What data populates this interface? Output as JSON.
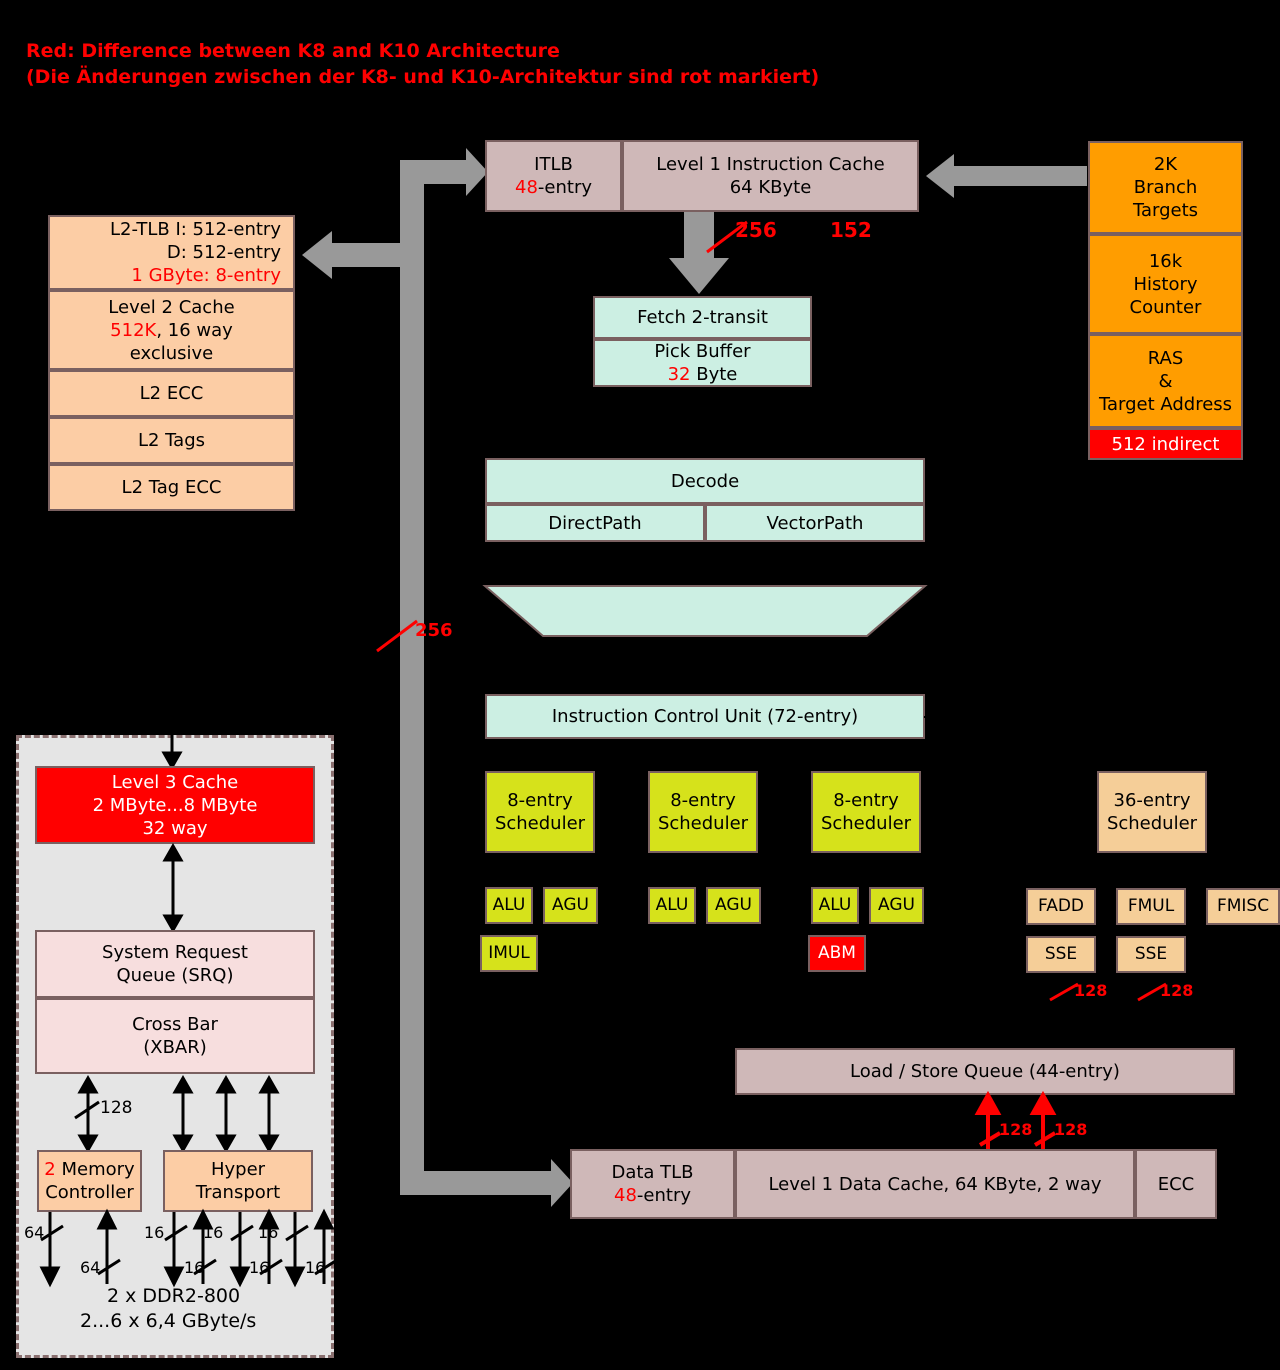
{
  "legend": {
    "line1": "Red: Difference between K8 and K10 Architecture",
    "line2": "(Die Änderungen zwischen der K8- und K10-Architektur sind rot markiert)",
    "color": "#FF0000"
  },
  "frontend": {
    "itlb": {
      "title": "ITLB",
      "value_red": "48",
      "value_rest": "-entry"
    },
    "l1_icache": {
      "line1": "Level 1 Instruction Cache",
      "line2": "64 KByte"
    },
    "bus_label_256": "256",
    "bus_label_152": "152",
    "fetch": {
      "line1": "Fetch 2-transit"
    },
    "pick_buffer": {
      "title": "Pick Buffer",
      "value_red": "32",
      "value_rest": " Byte"
    }
  },
  "l2_block": {
    "tlb": {
      "line1": "L2-TLB   I: 512-entry",
      "line2": "D: 512-entry",
      "line3_red": "1 GByte: 8-entry"
    },
    "l2_cache": {
      "line1": "Level 2 Cache",
      "size_red": "512K",
      "size_rest": ", 16 way",
      "line3": "exclusive"
    },
    "ecc": "L2 ECC",
    "tags": "L2 Tags",
    "tag_ecc": "L2 Tag ECC"
  },
  "branch_unit": {
    "branch_targets": {
      "line1": "2K",
      "line2": "Branch",
      "line3": "Targets"
    },
    "history_counter": {
      "line1": "16k",
      "line2": "History",
      "line3": "Counter"
    },
    "ras": {
      "line1": "RAS",
      "line2": "&",
      "line3": "Target Address"
    },
    "indirect": "512 indirect"
  },
  "decode": {
    "title": "Decode",
    "directpath": "DirectPath",
    "vectorpath": "VectorPath"
  },
  "icu": {
    "label": "Instruction Control Unit (72-entry)"
  },
  "int_schedulers": [
    {
      "line1": "8-entry",
      "line2": "Scheduler",
      "units": [
        "ALU",
        "AGU"
      ],
      "extra": "IMUL",
      "extra_red": false
    },
    {
      "line1": "8-entry",
      "line2": "Scheduler",
      "units": [
        "ALU",
        "AGU"
      ],
      "extra": null,
      "extra_red": false
    },
    {
      "line1": "8-entry",
      "line2": "Scheduler",
      "units": [
        "ALU",
        "AGU"
      ],
      "extra": "ABM",
      "extra_red": true
    }
  ],
  "fpu": {
    "scheduler": {
      "line1": "36-entry",
      "line2": "Scheduler"
    },
    "units": [
      "FADD",
      "FMUL",
      "FMISC"
    ],
    "sse": [
      "SSE",
      "SSE"
    ],
    "widths": [
      "128",
      "128"
    ]
  },
  "lsq": {
    "label": "Load / Store Queue (44-entry)",
    "widths": [
      "128",
      "128"
    ]
  },
  "data_row": {
    "dtlb": {
      "title": "Data TLB",
      "value_red": "48",
      "value_rest": "-entry"
    },
    "l1_dcache": "Level 1 Data Cache, 64 KByte, 2 way",
    "ecc": "ECC"
  },
  "northbridge": {
    "l3": {
      "line1": "Level 3 Cache",
      "line2": "2 MByte...8 MByte",
      "line3": "32 way"
    },
    "srq": {
      "line1": "System Request",
      "line2": "Queue (SRQ)"
    },
    "xbar": {
      "line1": "Cross Bar",
      "line2": "(XBAR)"
    },
    "bus_128": "128",
    "memctrl": {
      "count_red": "2",
      "line1": " Memory",
      "line2": "Controller"
    },
    "hypertransport": {
      "line1": "Hyper",
      "line2": "Transport"
    },
    "mem_widths": [
      "64",
      "64"
    ],
    "ht_widths": [
      "16",
      "16",
      "16",
      "16",
      "16",
      "16"
    ],
    "footer_line1": "2 x DDR2-800",
    "footer_line2": "2...6 x 6,4 GByte/s"
  },
  "bus_labels": {
    "left_256": "256"
  },
  "colors": {
    "peach": "#FCCDA5",
    "mauve": "#CFB8B8",
    "mint": "#CCEFE3",
    "orange": "#FF9D00",
    "red": "#FF0000",
    "yellow": "#D6E21B",
    "tan": "#F5CE98",
    "pink": "#F7DEDE",
    "gray_bus": "#999999",
    "background": "#000000"
  }
}
